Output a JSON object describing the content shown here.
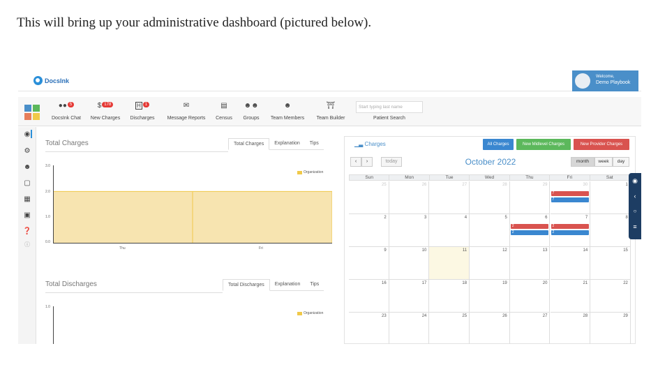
{
  "intro_text": "This will bring up your administrative dashboard (pictured below).",
  "app": {
    "logo_text": "DocsInk",
    "welcome_line1": "Welcome,",
    "welcome_line2": "Demo Playbook"
  },
  "toolbar": {
    "items": [
      {
        "label": "DocsInk Chat",
        "icon": "chat-icon",
        "badge": "5"
      },
      {
        "label": "New Charges",
        "icon": "dollar-icon",
        "badge": "178",
        "glyph": "$"
      },
      {
        "label": "Discharges",
        "icon": "hospital-icon",
        "badge": "1",
        "glyph": "H"
      },
      {
        "label": "Message Reports",
        "icon": "envelope-icon"
      },
      {
        "label": "Census",
        "icon": "list-icon"
      },
      {
        "label": "Groups",
        "icon": "group-icon"
      },
      {
        "label": "Team Members",
        "icon": "user-tie-icon"
      },
      {
        "label": "Team Builder",
        "icon": "bank-icon"
      }
    ],
    "search_placeholder": "Start typing last name",
    "search_label": "Patient Search"
  },
  "total_charges": {
    "title": "Total Charges",
    "tabs": [
      "Total Charges",
      "Explanation",
      "Tips"
    ],
    "legend": "Organization"
  },
  "total_discharges": {
    "title": "Total Discharges",
    "tabs": [
      "Total Discharges",
      "Explanation",
      "Tips"
    ],
    "legend": "Organization"
  },
  "chart_data": [
    {
      "type": "area",
      "title": "Total Charges",
      "categories": [
        "Thu",
        "Fri"
      ],
      "series": [
        {
          "name": "Organization",
          "values": [
            2.0,
            2.0
          ]
        }
      ],
      "y_ticks": [
        "3.0",
        "2.0",
        "1.0",
        "0.0"
      ],
      "ylim": [
        0,
        3
      ],
      "legend_position": "top-right",
      "color": "#f7e4b0"
    },
    {
      "type": "area",
      "title": "Total Discharges",
      "categories": [],
      "series": [
        {
          "name": "Organization",
          "values": []
        }
      ],
      "y_ticks": [
        "1.0"
      ],
      "ylim": [
        0,
        1
      ],
      "legend_position": "top-right"
    }
  ],
  "calendar": {
    "title": "Charges",
    "filters": [
      {
        "label": "All Charges",
        "color": "#3a87d0"
      },
      {
        "label": "New Midlevel Charges",
        "color": "#5cb85c"
      },
      {
        "label": "New Provider Charges",
        "color": "#d9534f"
      }
    ],
    "today_label": "today",
    "month_label": "October 2022",
    "views": [
      "month",
      "week",
      "day"
    ],
    "active_view": "month",
    "days_of_week": [
      "Sun",
      "Mon",
      "Tue",
      "Wed",
      "Thu",
      "Fri",
      "Sat"
    ],
    "weeks": [
      [
        "25",
        "26",
        "27",
        "28",
        "29",
        "30",
        "1"
      ],
      [
        "2",
        "3",
        "4",
        "5",
        "6",
        "7",
        "8"
      ],
      [
        "9",
        "10",
        "11",
        "12",
        "13",
        "14",
        "15"
      ],
      [
        "16",
        "17",
        "18",
        "19",
        "20",
        "21",
        "22"
      ],
      [
        "23",
        "24",
        "25",
        "26",
        "27",
        "28",
        "29"
      ]
    ],
    "today_date": "11",
    "events": [
      {
        "week": 0,
        "day": 5,
        "label": "7",
        "color": "red"
      },
      {
        "week": 0,
        "day": 5,
        "label": "7",
        "color": "blue"
      },
      {
        "week": 1,
        "day": 4,
        "label": "2",
        "color": "red"
      },
      {
        "week": 1,
        "day": 4,
        "label": "2",
        "color": "blue"
      },
      {
        "week": 1,
        "day": 5,
        "label": "2",
        "color": "red"
      },
      {
        "week": 1,
        "day": 5,
        "label": "2",
        "color": "blue"
      }
    ]
  },
  "colors": {
    "accent": "#4a8fc9",
    "chart_fill": "#f7e4b0",
    "chart_stroke": "#f0c94a",
    "apps_tiles": [
      "#4a8fc9",
      "#5cb85c",
      "#e67e5b",
      "#f0c94a"
    ]
  }
}
